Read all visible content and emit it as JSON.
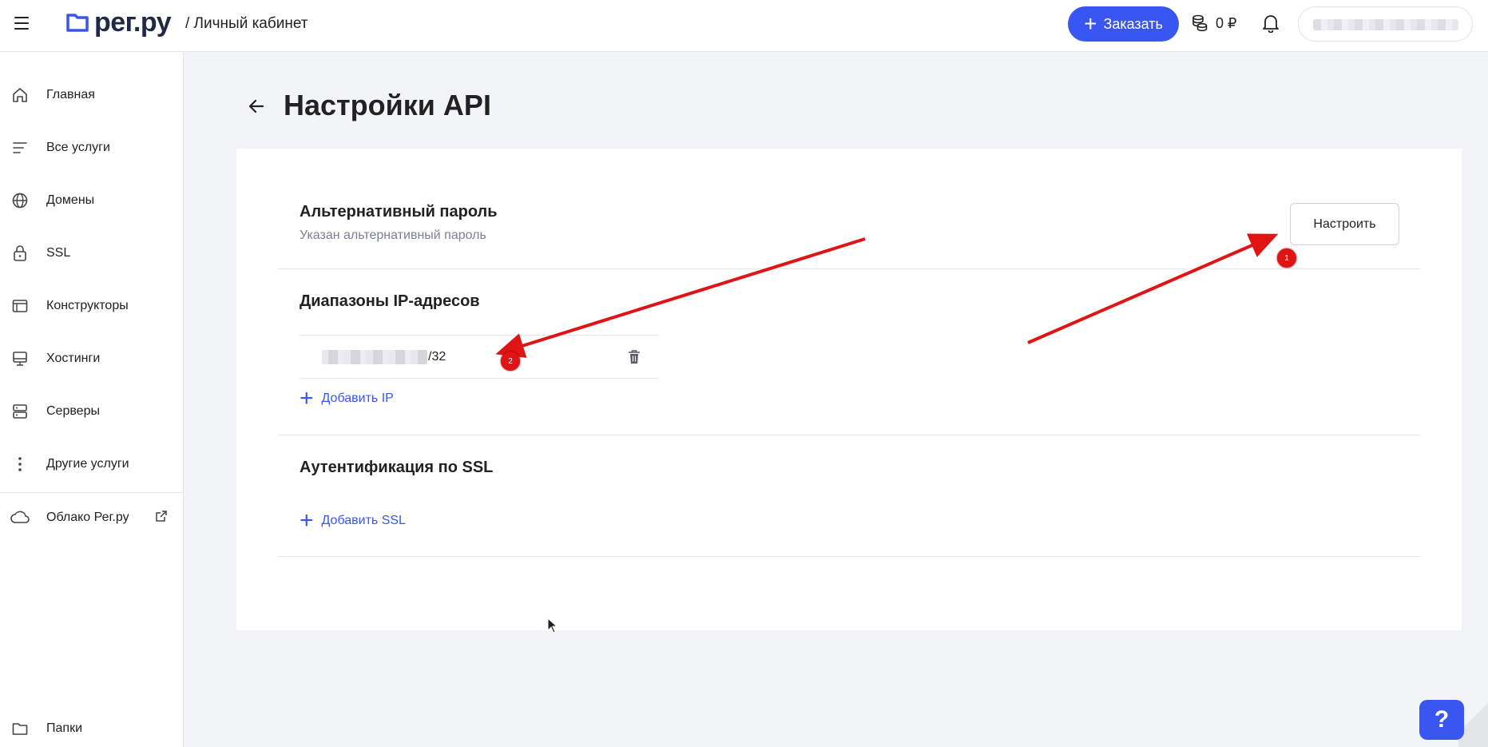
{
  "header": {
    "brand": "рег.ру",
    "breadcrumb": "/ Личный кабинет",
    "order_label": "Заказать",
    "balance": "0 ₽"
  },
  "sidebar": {
    "items": [
      {
        "label": "Главная",
        "icon": "home-icon"
      },
      {
        "label": "Все услуги",
        "icon": "list-icon"
      },
      {
        "label": "Домены",
        "icon": "globe-icon"
      },
      {
        "label": "SSL",
        "icon": "lock-icon"
      },
      {
        "label": "Конструкторы",
        "icon": "browser-icon"
      },
      {
        "label": "Хостинги",
        "icon": "monitor-icon"
      },
      {
        "label": "Серверы",
        "icon": "server-icon"
      },
      {
        "label": "Другие услуги",
        "icon": "more-vertical-icon"
      },
      {
        "label": "Облако Рег.ру",
        "icon": "cloud-icon"
      },
      {
        "label": "Папки",
        "icon": "folder-icon"
      }
    ]
  },
  "page": {
    "title": "Настройки API",
    "alt_password": {
      "title": "Альтернативный пароль",
      "subtitle": "Указан альтернативный пароль",
      "configure_label": "Настроить"
    },
    "ip_ranges": {
      "title": "Диапазоны IP-адресов",
      "entries": [
        {
          "suffix": "/32"
        }
      ],
      "add_label": "Добавить IP"
    },
    "ssl_auth": {
      "title": "Аутентификация по SSL",
      "add_label": "Добавить SSL"
    }
  },
  "annotations": {
    "badge_1": "1",
    "badge_2": "2"
  },
  "help": {
    "label": "?"
  },
  "colors": {
    "accent": "#3a56f0",
    "annotation": "#e01414"
  }
}
